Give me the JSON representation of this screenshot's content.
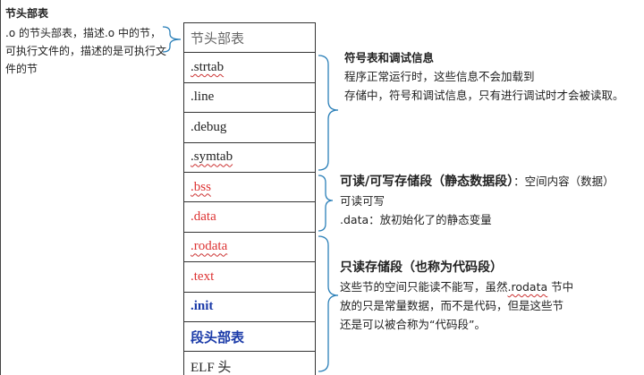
{
  "note": {
    "title": "节头部表",
    "text": ".o 的节头部表，描述.o 中的节，可执行文件的，描述的是可执行文件的节"
  },
  "sections": [
    ".strtab",
    ".line",
    ".debug",
    ".symtab",
    ".bss",
    ".data",
    ".rodata",
    ".text",
    ".init",
    "段头部表",
    "ELF 头"
  ],
  "table_header": "节头部表",
  "desc_symbols": {
    "title": "符号表和调试信息",
    "line1": "程序正常运行时，这些信息不会加载到",
    "line2": "存储中，符号和调试信息，只有进行调试时才会被读取。"
  },
  "desc_rw": {
    "title": "可读/可写存储段（静态数据段）",
    "title_suffix": "：空间内容（数据）",
    "line1": "可读可写",
    "line2": ".data：放初始化了的静态变量"
  },
  "desc_ro": {
    "title": "只读存储段（也称为代码段）",
    "line1a": "这些节的空间只能读不能写，虽然",
    "line1b": ".rodata",
    "line1c": " 节中",
    "line2": "放的只是常量数据，而不是代码，但是这些节",
    "line3": "还是可以被合称为“代码段”。"
  },
  "colors": {
    "red": "#d33333",
    "blue": "#1a3aa8",
    "brace": "#2a7fb8"
  }
}
